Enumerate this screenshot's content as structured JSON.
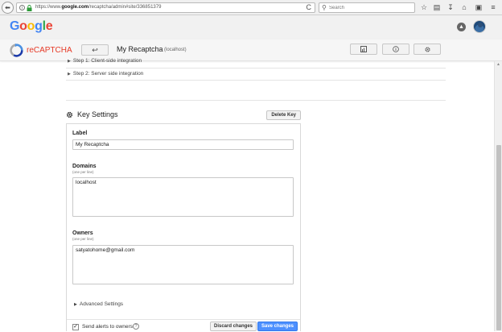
{
  "browser": {
    "url_prefix": "https://www.",
    "url_domain": "google.com",
    "url_path": "/recaptcha/admin#site/336851379",
    "search_placeholder": "Search",
    "back_glyph": "⬅",
    "reload_glyph": "C"
  },
  "google": {
    "logo": [
      "G",
      "o",
      "o",
      "g",
      "l",
      "e"
    ]
  },
  "recaptcha": {
    "title": "reCAPTCHA",
    "back_glyph": "↩",
    "site_name": "My Recaptcha",
    "site_domain": "(localhost)"
  },
  "steps": [
    {
      "label": "Step 1: Client-side integration"
    },
    {
      "label": "Step 2: Server side integration"
    }
  ],
  "key_settings": {
    "title": "Key Settings",
    "delete_label": "Delete Key",
    "label_title": "Label",
    "label_value": "My Recaptcha",
    "domains_title": "Domains",
    "domains_hint": "(one per line)",
    "domains_value": "localhost",
    "owners_title": "Owners",
    "owners_hint": "(one per line)",
    "owners_value": "satyatohome@gmail.com",
    "advanced_label": "Advanced Settings",
    "send_alerts_label": "Send alerts to owners",
    "send_alerts_checked": true,
    "discard_label": "Discard changes",
    "save_label": "Save changes"
  },
  "colors": {
    "accent_blue": "#4d90fe",
    "recaptcha_red": "#e63a27"
  }
}
